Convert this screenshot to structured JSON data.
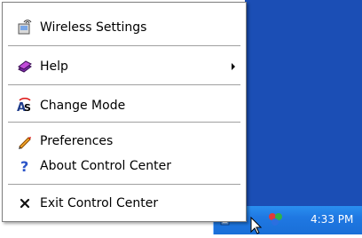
{
  "menu": {
    "items": [
      {
        "label": "Wireless Settings",
        "icon": "wireless-settings-icon"
      },
      {
        "label": "Help",
        "icon": "help-book-icon",
        "has_submenu": true
      },
      {
        "label": "Change Mode",
        "icon": "change-mode-icon"
      },
      {
        "label": "Preferences",
        "icon": "pencil-icon"
      },
      {
        "label": "About Control Center",
        "icon": "question-mark-icon"
      },
      {
        "label": "Exit Control Center",
        "icon": "close-x-icon"
      }
    ]
  },
  "taskbar": {
    "clock": "4:33 PM"
  },
  "colors": {
    "desktop_blue": "#1b4eb5",
    "taskbar_blue": "#1f78e2",
    "menu_bg": "#ffffff",
    "separator": "#a0a0a0"
  }
}
